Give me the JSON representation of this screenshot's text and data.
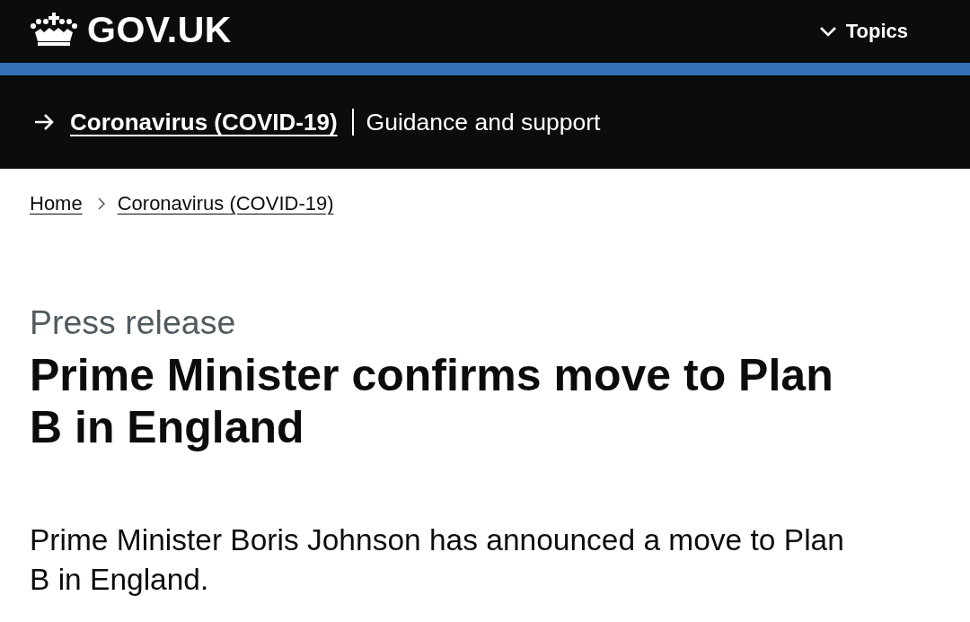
{
  "header": {
    "logo": "GOV.UK",
    "menu": {
      "label": "Topics",
      "expanded": false
    }
  },
  "banner": {
    "link": "Coronavirus (COVID-19)",
    "label": "Guidance and support"
  },
  "breadcrumbs": [
    {
      "label": "Home"
    },
    {
      "label": "Coronavirus (COVID-19)"
    }
  ],
  "article": {
    "caption": "Press release",
    "title": "Prime Minister confirms move to Plan B in England",
    "lede": "Prime Minister Boris Johnson has announced a move to Plan B in England."
  }
}
